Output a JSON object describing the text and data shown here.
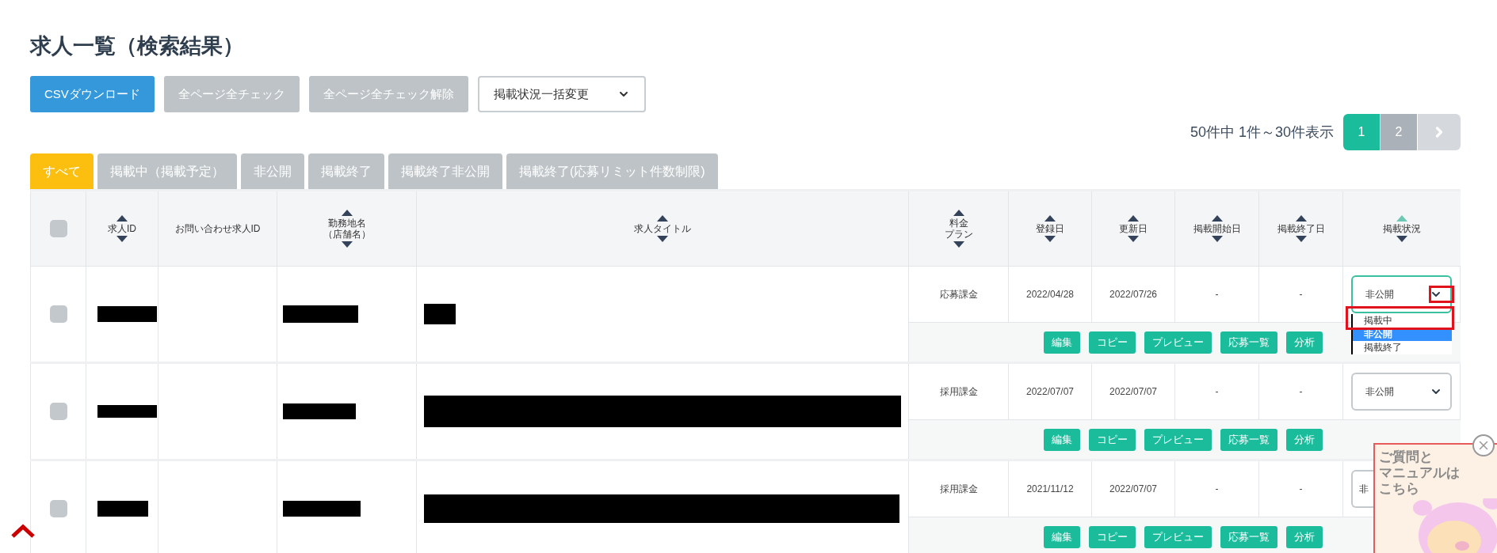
{
  "title": "求人一覧（検索結果）",
  "toolbar": {
    "buttons": [
      {
        "label": "CSVダウンロード",
        "kind": "primary"
      },
      {
        "label": "全ページ全チェック",
        "kind": "muted"
      },
      {
        "label": "全ページ全チェック解除",
        "kind": "muted"
      }
    ],
    "bulk_select": {
      "value": "掲載状況一括変更"
    }
  },
  "pagination": {
    "summary": "50件中 1件～30件表示",
    "pages": [
      {
        "label": "1",
        "selected": true
      },
      {
        "label": "2",
        "selected": false
      }
    ]
  },
  "tabs": [
    {
      "label": "すべて",
      "selected": true
    },
    {
      "label": "掲載中（掲載予定）",
      "selected": false
    },
    {
      "label": "非公開",
      "selected": false
    },
    {
      "label": "掲載終了",
      "selected": false
    },
    {
      "label": "掲載終了非公開",
      "selected": false
    },
    {
      "label": "掲載終了(応募リミット件数制限)",
      "selected": false
    }
  ],
  "table": {
    "columns": [
      {
        "kind": "checkbox",
        "checked": false
      },
      {
        "kind": "text",
        "label": "求人ID",
        "sortable": true,
        "sort_active": false
      },
      {
        "kind": "text",
        "label": "お問い合わせ求人ID",
        "sortable": false
      },
      {
        "kind": "text",
        "lines": [
          "勤務地名",
          "（店舗名）"
        ],
        "sortable": true,
        "sort_active": false
      },
      {
        "kind": "text",
        "label": "求人タイトル",
        "sortable": true,
        "sort_active": false
      },
      {
        "kind": "text",
        "lines": [
          "料金",
          "プラン"
        ],
        "sortable": true,
        "sort_active": false
      },
      {
        "kind": "text",
        "label": "登録日",
        "sortable": true,
        "sort_active": false
      },
      {
        "kind": "text",
        "label": "更新日",
        "sortable": true,
        "sort_active": false
      },
      {
        "kind": "text",
        "label": "掲載開始日",
        "sortable": true,
        "sort_active": false
      },
      {
        "kind": "text",
        "label": "掲載終了日",
        "sortable": true,
        "sort_active": false
      },
      {
        "kind": "text",
        "label": "掲載状況",
        "sortable": true,
        "sort_active": true
      }
    ],
    "rows": [
      {
        "checked": false,
        "plan": "応募課金",
        "registered": "2022/04/28",
        "updated": "2022/07/26",
        "start": "-",
        "end": "-",
        "status": {
          "value": "非公開",
          "chevron_visible": true,
          "open": true,
          "options": [
            {
              "label": "掲載中",
              "selected": false
            },
            {
              "label": "非公開",
              "selected": true
            },
            {
              "label": "掲載終了",
              "selected": false
            }
          ]
        },
        "actions": [
          "編集",
          "コピー",
          "プレビュー",
          "応募一覧",
          "分析"
        ]
      },
      {
        "checked": false,
        "plan": "採用課金",
        "registered": "2022/07/07",
        "updated": "2022/07/07",
        "start": "-",
        "end": "-",
        "status": {
          "value": "非公開",
          "chevron_visible": true,
          "open": false
        },
        "actions": [
          "編集",
          "コピー",
          "プレビュー",
          "応募一覧",
          "分析"
        ]
      },
      {
        "checked": false,
        "plan": "採用課金",
        "registered": "2021/11/12",
        "updated": "2022/07/07",
        "start": "-",
        "end": "-",
        "status": {
          "value": "非",
          "chevron_visible": false,
          "open": false
        },
        "actions": [
          "編集",
          "コピー",
          "プレビュー",
          "応募一覧",
          "分析"
        ]
      }
    ]
  },
  "help_widget": {
    "lines": [
      "ご質問と",
      "マニュアルは",
      "こちら"
    ]
  }
}
